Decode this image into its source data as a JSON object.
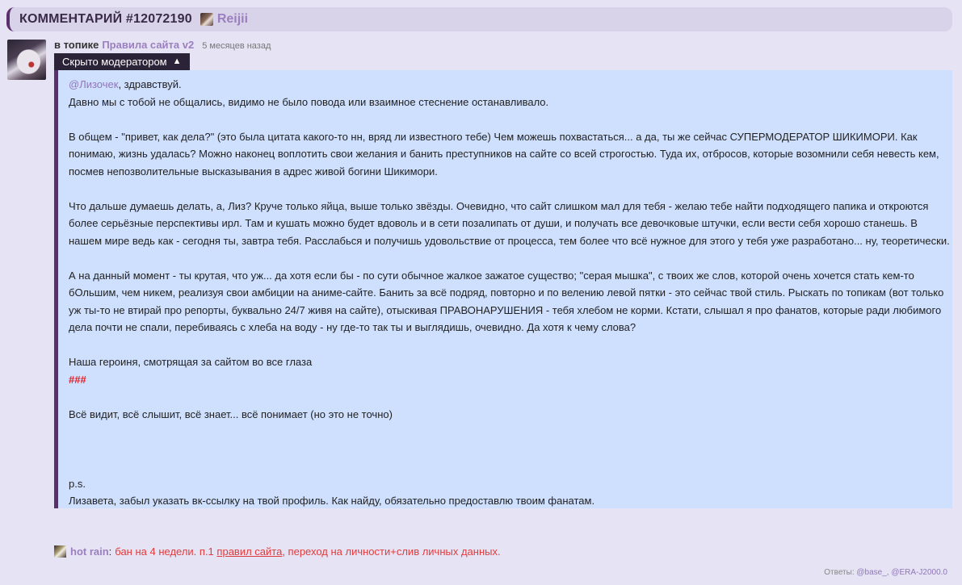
{
  "header": {
    "title": "КОММЕНТАРИЙ #12072190",
    "username": "Reijii"
  },
  "meta": {
    "prefix": "в топике",
    "topic": "Правила сайта v2",
    "time": "5 месяцев назад"
  },
  "moderation": {
    "hidden_label": "Скрыто модератором"
  },
  "comment": {
    "mention": "@Лизочек",
    "greeting_rest": ", здравствуй.",
    "line_1": "Давно мы с тобой не общались, видимо не было повода или взаимное стеснение останавливало.",
    "para_2": "В общем - \"привет, как дела?\" (это была цитата какого-то нн, вряд ли известного тебе) Чем можешь похвастаться... а да, ты же сейчас СУПЕРМОДЕРАТОР ШИКИМОРИ. Как понимаю, жизнь удалась? Можно наконец воплотить свои желания и банить преступников на сайте со всей строгостью. Туда их, отбросов, которые возомнили себя невесть кем, посмев непозволительные высказывания в адрес живой богини Шикимори.",
    "para_3": "Что дальше думаешь делать, а, Лиз? Круче только яйца, выше только звёзды. Очевидно, что сайт слишком мал для тебя - желаю тебе найти подходящего папика и откроются более серьёзные перспективы ирл. Там и кушать можно будет вдоволь и в сети позалипать от души, и получать все девочковые штучки, если вести себя хорошо станешь. В нашем мире ведь как - сегодня ты, завтра тебя. Расслабься и получишь удовольствие от процесса, тем более что всё нужное для этого у тебя уже разработано... ну, теоретически.",
    "para_4": "А на данный момент - ты крутая, что уж... да хотя если бы - по сути обычное жалкое зажатое существо; \"серая мышка\", с твоих же слов, которой очень хочется стать кем-то бОльшим, чем никем, реализуя свои амбиции на аниме-сайте. Банить за всё подряд, повторно и по велению левой пятки - это сейчас твой стиль. Рыскать по топикам (вот только уж ты-то не втирай про репорты, буквально 24/7 живя на сайте), отыскивая ПРАВОНАРУШЕНИЯ - тебя хлебом не корми. Кстати, слышал я про фанатов, которые ради любимого дела почти не спали, перебиваясь с хлеба на воду - ну где-то так ты и выглядишь, очевидно. Да хотя к чему слова?",
    "heroine_line": "Наша героиня, смотрящая за сайтом во все глаза",
    "red_mark": "###",
    "sees_line": "Всё видит, всё слышит, всё знает... всё понимает (но это не точно)",
    "ps": "p.s.",
    "ps_text": "Лизавета, забыл указать вк-ссылку на твой профиль. Как найду, обязательно предоставлю твоим фанатам."
  },
  "mod_note": {
    "moderator": "hot rain",
    "colon": ":",
    "ban_before": "бан на 4 недели. п.1",
    "ban_link": "правил сайта",
    "ban_after": ", переход на личности+слив личных данных."
  },
  "replies": {
    "label": "Ответы:",
    "user_1": "@base_",
    "separator": ", ",
    "user_2": "@ERA-J2000.0"
  },
  "colors": {
    "accent": "#5a2f6b",
    "link": "#9b7fbf",
    "ban": "#e23b3b",
    "body_bg": "#cfe0ff",
    "page_bg": "#e6e3f4"
  }
}
